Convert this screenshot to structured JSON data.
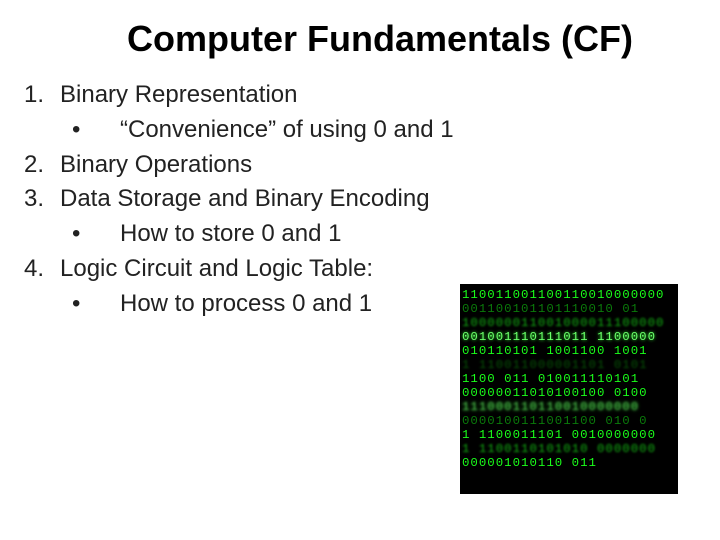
{
  "title": "Computer Fundamentals (CF)",
  "items": [
    {
      "n": "1.",
      "text": "Binary Representation",
      "sub": [
        "“Convenience” of using 0 and 1"
      ]
    },
    {
      "n": "2.",
      "text": "Binary Operations",
      "sub": []
    },
    {
      "n": "3.",
      "text": "Data Storage and Binary Encoding",
      "sub": [
        "How to store 0 and 1"
      ]
    },
    {
      "n": "4.",
      "text": "Logic Circuit and Logic Table:",
      "sub": [
        "How to process 0 and 1"
      ]
    }
  ],
  "matrix_rows": [
    "110011001100110010000000",
    "001100101101110010 01",
    "100000011001000011100000",
    "001001110111011 1100000",
    "010110101 1001100 1001",
    "1 110011000001101 0101",
    "1100 011 010011110101",
    "00000011010100100 0100",
    "111000110110010000000",
    "0000100111001100 010 0",
    "1 1100011101 0010000000",
    "1 1100110101010 0000000",
    "000001010110 011 "
  ]
}
